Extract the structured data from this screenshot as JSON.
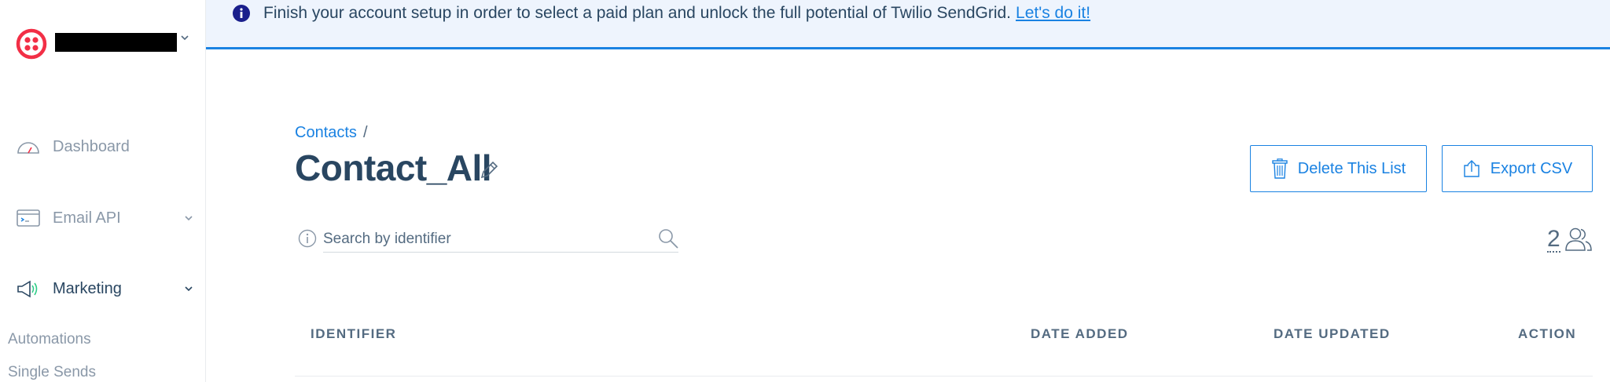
{
  "banner": {
    "text": "Finish your account setup in order to select a paid plan and unlock the full potential of Twilio SendGrid.",
    "link": "Let's do it!"
  },
  "sidebar": {
    "items": [
      {
        "label": "Dashboard",
        "icon": "dashboard-gauge-icon"
      },
      {
        "label": "Email API",
        "icon": "email-api-icon"
      },
      {
        "label": "Marketing",
        "icon": "megaphone-icon"
      }
    ],
    "sub_items": [
      "Automations",
      "Single Sends"
    ]
  },
  "main": {
    "breadcrumb": {
      "link": "Contacts",
      "sep": "/"
    },
    "title": "Contact_All",
    "buttons": {
      "delete": "Delete This List",
      "export": "Export CSV"
    },
    "search": {
      "placeholder": "Search by identifier"
    },
    "count": "2",
    "table": {
      "headers": [
        "IDENTIFIER",
        "DATE ADDED",
        "DATE UPDATED",
        "ACTION"
      ]
    }
  },
  "colors": {
    "brand_red": "#f22f46",
    "accent_blue": "#1a82e2",
    "navy": "#294661"
  }
}
